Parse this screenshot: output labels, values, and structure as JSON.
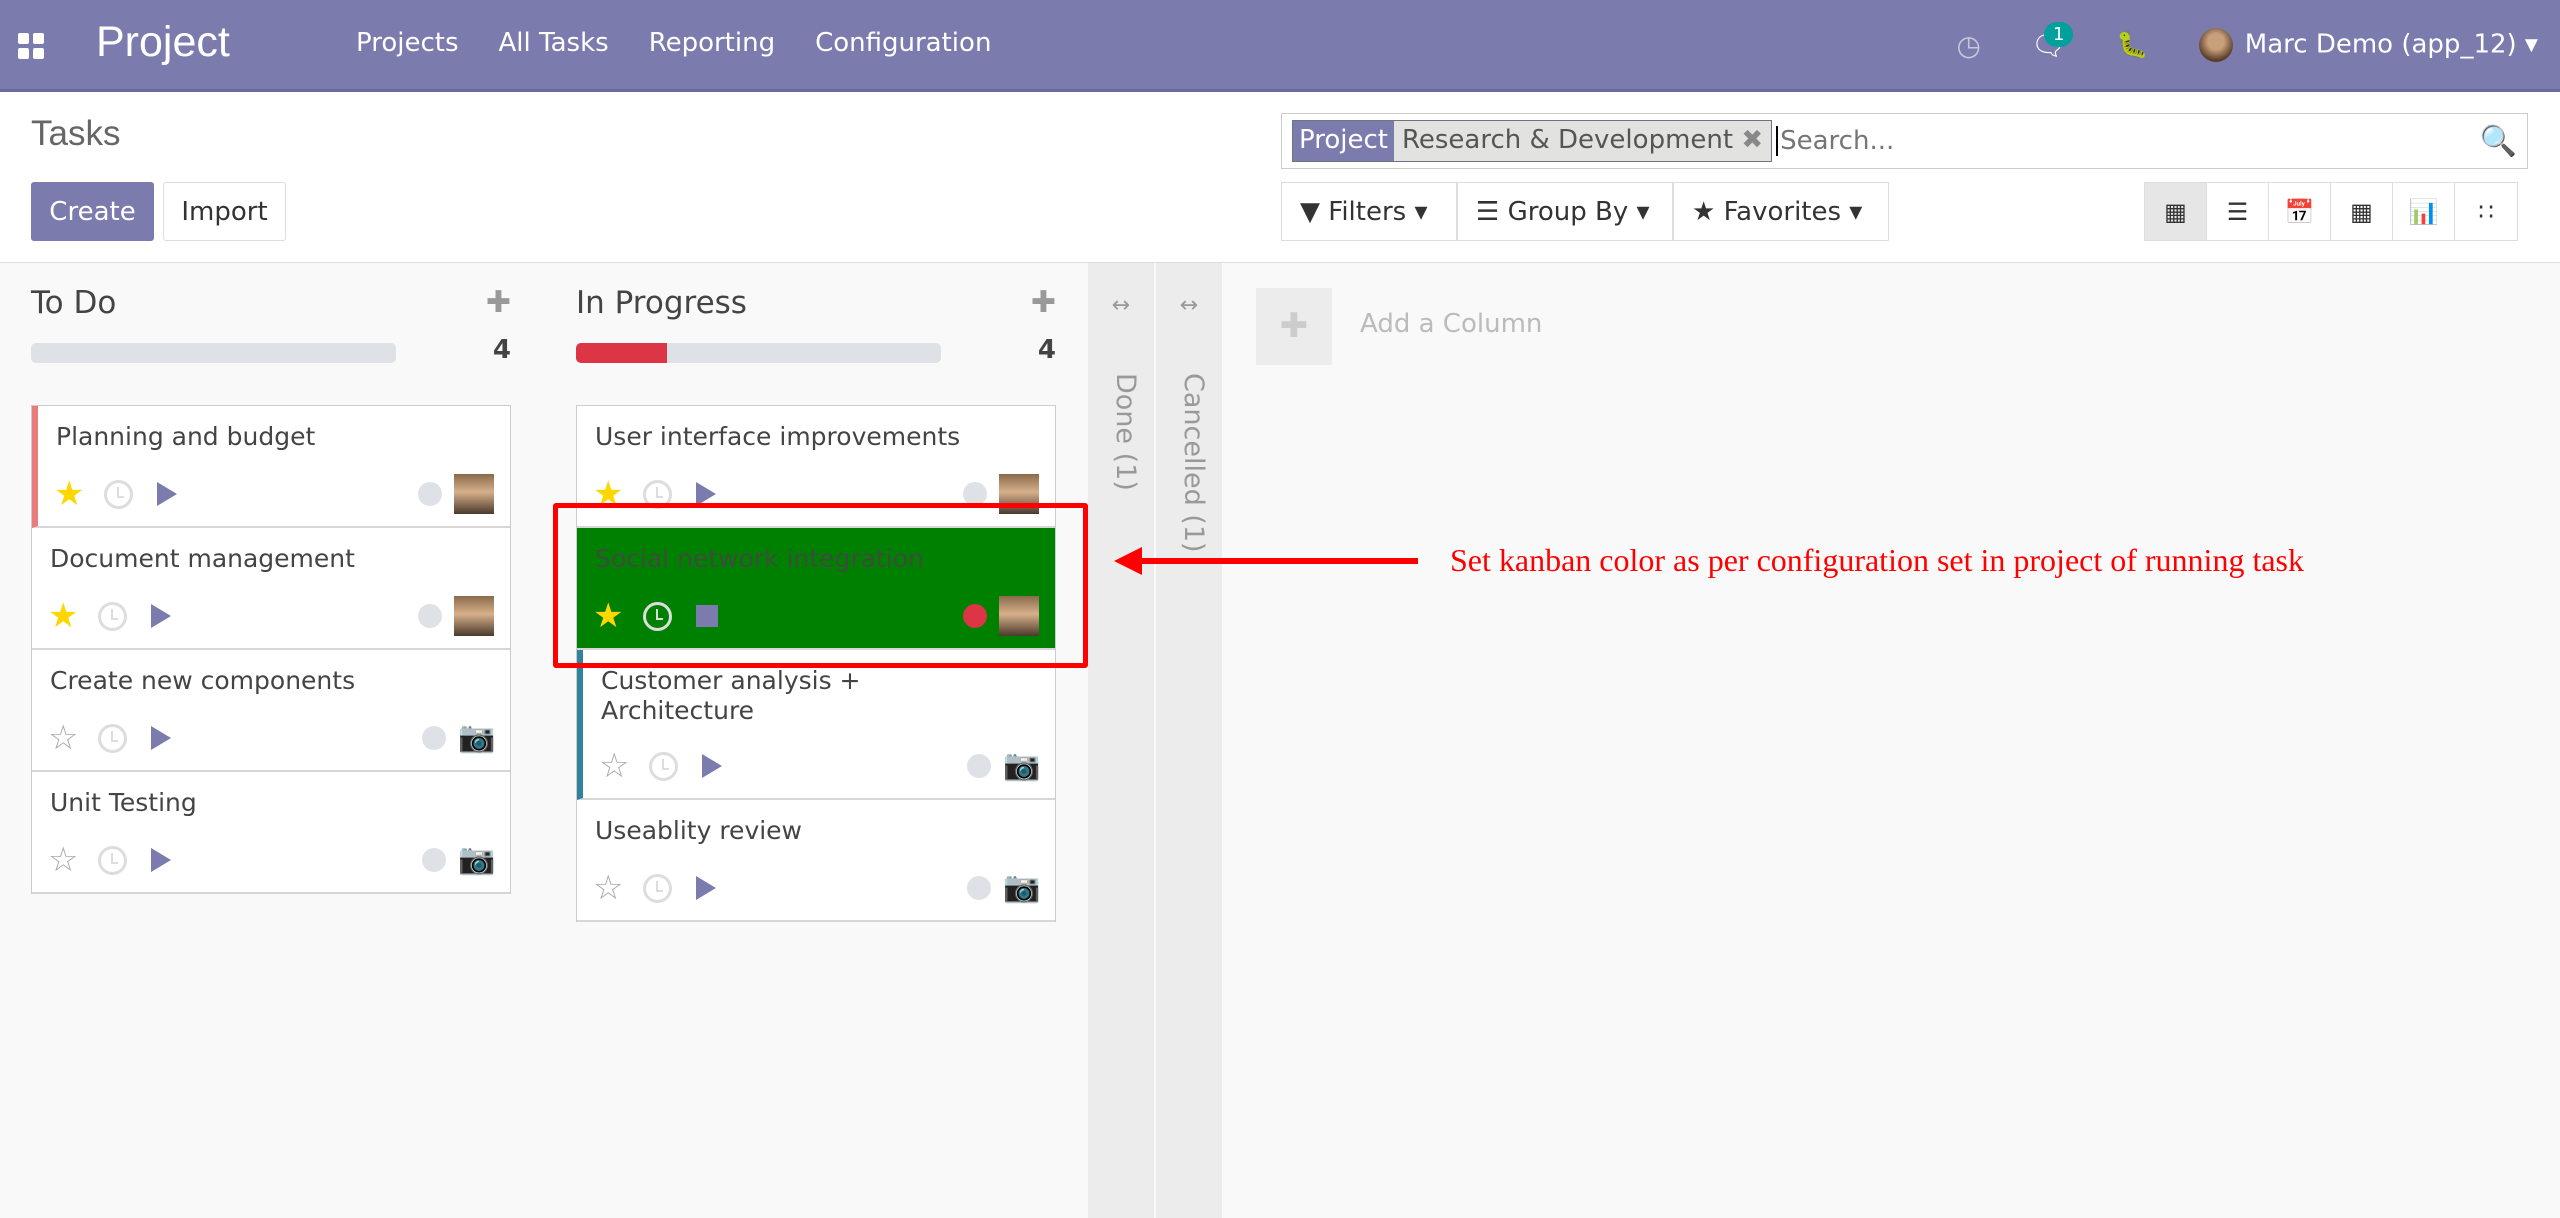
{
  "navbar": {
    "app_name": "Project",
    "menu": [
      "Projects",
      "All Tasks",
      "Reporting",
      "Configuration"
    ],
    "chat_count": "1",
    "user": "Marc Demo (app_12)"
  },
  "control_panel": {
    "title": "Tasks",
    "create_label": "Create",
    "import_label": "Import",
    "search": {
      "facet_key": "Project",
      "facet_value": "Research & Development",
      "placeholder": "Search..."
    },
    "filters_label": "Filters",
    "groupby_label": "Group By",
    "favorites_label": "Favorites"
  },
  "columns": [
    {
      "title": "To Do",
      "count": "4",
      "progress_red": 0,
      "cards": [
        {
          "title": "Planning and budget",
          "starred": true
        },
        {
          "title": "Document management",
          "starred": true
        },
        {
          "title": "Create new components",
          "starred": false
        },
        {
          "title": "Unit Testing",
          "starred": false
        }
      ]
    },
    {
      "title": "In Progress",
      "count": "4",
      "progress_red": 0.25,
      "cards": [
        {
          "title": "User interface improvements",
          "starred": true
        },
        {
          "title": "Social network integration",
          "starred": true,
          "running": true,
          "kanban_color": "#008000"
        },
        {
          "title": "Customer analysis + Architecture",
          "starred": false
        },
        {
          "title": "Useablity review",
          "starred": false
        }
      ]
    }
  ],
  "folded": [
    {
      "label": "Done (1)"
    },
    {
      "label": "Cancelled (1)"
    }
  ],
  "add_column": "Add a Column",
  "annotation": "Set kanban color as per configuration set in project of running task",
  "colors": {
    "brand": "#7c7bad",
    "running_card": "#008000",
    "annotation": "#ff0000"
  }
}
